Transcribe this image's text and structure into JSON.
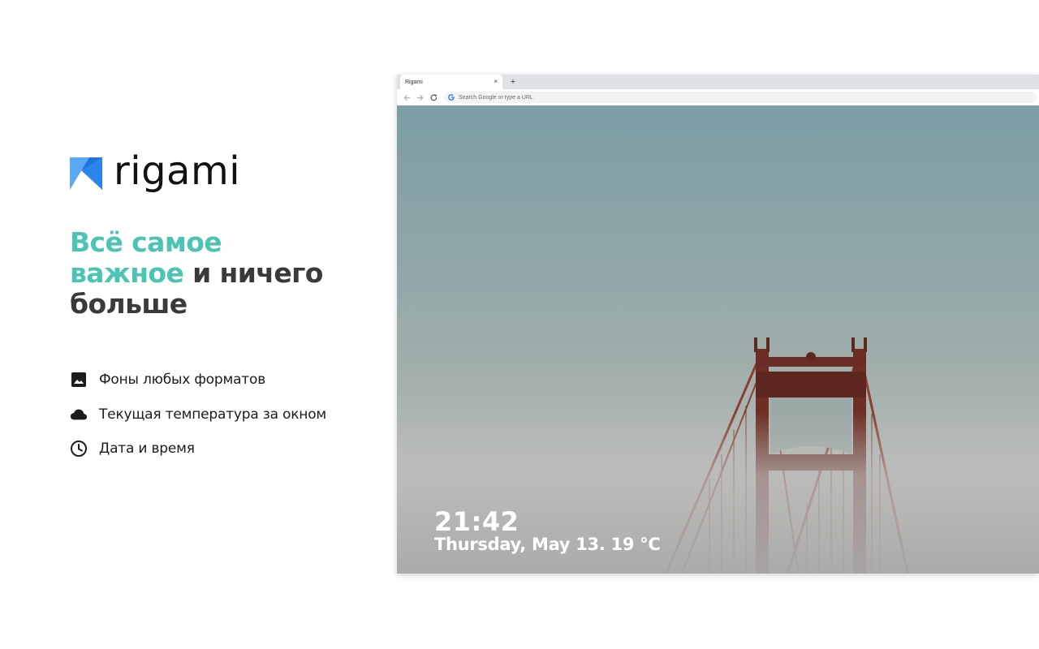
{
  "brand": {
    "name": "rigami",
    "colors": {
      "accent": "#4cc4b4",
      "logo_light": "#5aa9f5",
      "logo_dark": "#1f74e0"
    }
  },
  "headline": {
    "accent_line1": "Всё самое",
    "accent_line2": "важное",
    "rest_line2": " и ничего",
    "line3": "больше"
  },
  "features": [
    {
      "icon": "image-icon",
      "label": "Фоны любых форматов"
    },
    {
      "icon": "cloud-icon",
      "label": "Текущая температура за окном"
    },
    {
      "icon": "clock-icon",
      "label": "Дата и время"
    }
  ],
  "browser": {
    "tab_title": "Rigami",
    "tab_close": "×",
    "new_tab": "+",
    "omnibox_placeholder": "Search Google or type a URL"
  },
  "newtab": {
    "time": "21:42",
    "date_weather": "Thursday, May 13. 19 °C"
  }
}
